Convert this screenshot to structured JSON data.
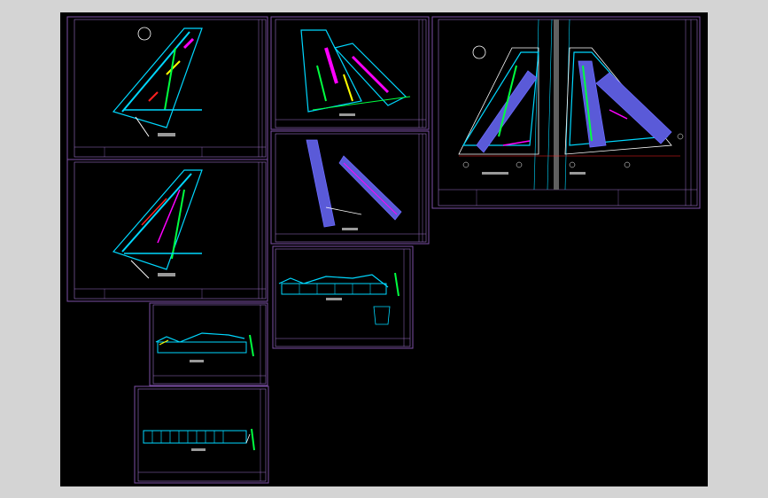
{
  "app": {
    "kind": "cad-model-space-viewer"
  },
  "colors": {
    "background": "#000000",
    "frame": "#7b4fa6",
    "cyan": "#00d8ff",
    "magenta": "#ff00ff",
    "green": "#00ff40",
    "yellow": "#ffff00",
    "red": "#ff2020",
    "blue": "#6a6aff",
    "white": "#ffffff"
  },
  "sheets": [
    {
      "id": "plan-1",
      "title": "",
      "type": "site-plan"
    },
    {
      "id": "plan-2",
      "title": "",
      "type": "site-plan"
    },
    {
      "id": "plan-3",
      "title": "",
      "type": "floor-plan"
    },
    {
      "id": "plan-4",
      "title": "",
      "type": "roof-plan"
    },
    {
      "id": "plan-5",
      "title": "",
      "type": "master-plan"
    },
    {
      "id": "elevation-1",
      "title": "",
      "type": "elevation"
    },
    {
      "id": "elevation-2",
      "title": "",
      "type": "elevation"
    },
    {
      "id": "elevation-3",
      "title": "",
      "type": "elevation"
    }
  ]
}
